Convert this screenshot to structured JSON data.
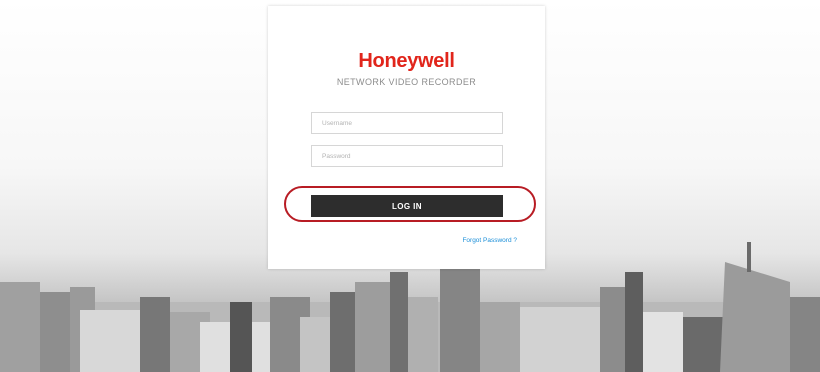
{
  "brand": {
    "logo_text": "Honeywell",
    "subtitle": "NETWORK VIDEO RECORDER",
    "color": "#e1251b"
  },
  "login": {
    "username_placeholder": "Username",
    "password_placeholder": "Password",
    "button_label": "LOG IN",
    "forgot_link": "Forgot Password ?"
  },
  "colors": {
    "button": "#2d2d2d",
    "link": "#1c8fd8",
    "highlight": "#b81c24"
  }
}
